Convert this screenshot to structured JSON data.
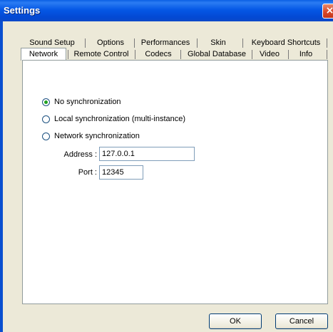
{
  "window": {
    "title": "Settings",
    "close_glyph": "×"
  },
  "tabs_back": [
    "Sound Setup",
    "Options",
    "Performances",
    "Skin",
    "Keyboard Shortcuts"
  ],
  "tabs_front": [
    "Network",
    "Remote Control",
    "Codecs",
    "Global Database",
    "Video",
    "Info"
  ],
  "active_tab": "Network",
  "sync_options": [
    {
      "label": "No synchronization",
      "checked": true
    },
    {
      "label": "Local synchronization (multi-instance)",
      "checked": false
    },
    {
      "label": "Network synchronization",
      "checked": false
    }
  ],
  "address": {
    "label": "Address :",
    "value": "127.0.0.1"
  },
  "port": {
    "label": "Port :",
    "value": "12345"
  },
  "buttons": {
    "ok": "OK",
    "cancel": "Cancel"
  },
  "colors": {
    "title_bar": "#0558e6",
    "dialog_bg": "#ece9d8",
    "close_button": "#d8482a"
  }
}
